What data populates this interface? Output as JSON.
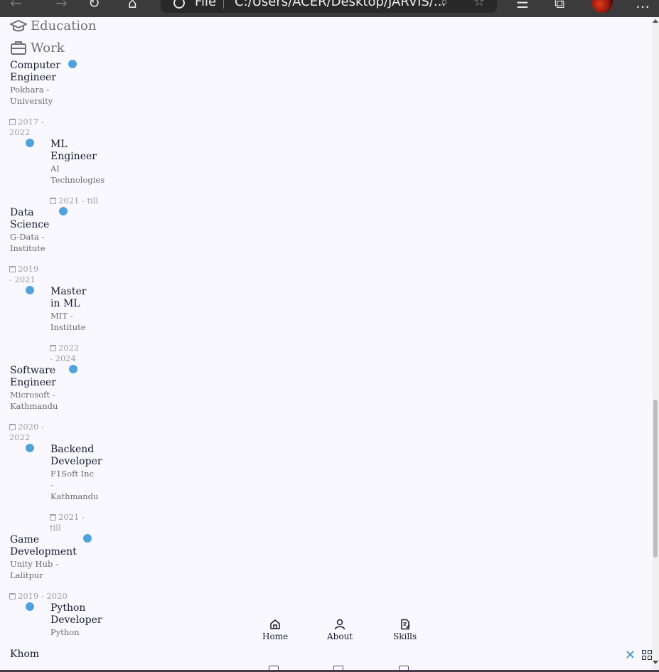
{
  "browser": {
    "address_label": "File",
    "address_path": "C:/Users/ACER/Desktop/JARVIS/..."
  },
  "qualification": {
    "tabs": [
      {
        "label": "Education",
        "icon": "graduation-cap-icon"
      },
      {
        "label": "Work",
        "icon": "briefcase-icon"
      }
    ]
  },
  "timeline": [
    {
      "title_lines": [
        "Computer",
        "Engineer"
      ],
      "subtitle_lines": [
        "Pokhara -",
        "University"
      ],
      "date_lines": [
        "2017 -",
        "2022"
      ]
    },
    {
      "title_lines": [
        "ML",
        "Engineer"
      ],
      "subtitle_lines": [
        "AI",
        "Technologies"
      ],
      "date_lines": [
        "2021 - till"
      ]
    },
    {
      "title_lines": [
        "Data",
        "Science"
      ],
      "subtitle_lines": [
        "G-Data -",
        "Institute"
      ],
      "date_lines": [
        "2019",
        "- 2021"
      ]
    },
    {
      "title_lines": [
        "Master",
        "in ML"
      ],
      "subtitle_lines": [
        "MIT -",
        "Institute"
      ],
      "date_lines": [
        "2022",
        "- 2024"
      ]
    },
    {
      "title_lines": [
        "Software",
        "Engineer"
      ],
      "subtitle_lines": [
        "Microsoft -",
        "Kathmandu"
      ],
      "date_lines": [
        "2020 -",
        "2022"
      ]
    },
    {
      "title_lines": [
        "Backend",
        "Developer"
      ],
      "subtitle_lines": [
        "F1Soft Inc",
        "-",
        "Kathmandu"
      ],
      "date_lines": [
        "2021 -",
        "till"
      ]
    },
    {
      "title_lines": [
        "Game",
        "Development"
      ],
      "subtitle_lines": [
        "Unity Hub -",
        "Lalitpur"
      ],
      "date_lines": [
        "2019 - 2020"
      ]
    },
    {
      "title_lines": [
        "Python",
        "Developer"
      ],
      "subtitle_lines": [
        "Python"
      ],
      "date_lines": []
    }
  ],
  "nav": {
    "items": [
      {
        "label": "Home",
        "icon": "home-icon"
      },
      {
        "label": "About",
        "icon": "user-icon"
      },
      {
        "label": "Skills",
        "icon": "file-edit-icon"
      }
    ],
    "logo": "Khom",
    "close_icon": "close-icon",
    "grid_icon": "grid-icon"
  },
  "colors": {
    "accent": "#4fa3dd",
    "background": "#f8f8fe",
    "title": "#1a1a2e",
    "muted": "#707070"
  }
}
